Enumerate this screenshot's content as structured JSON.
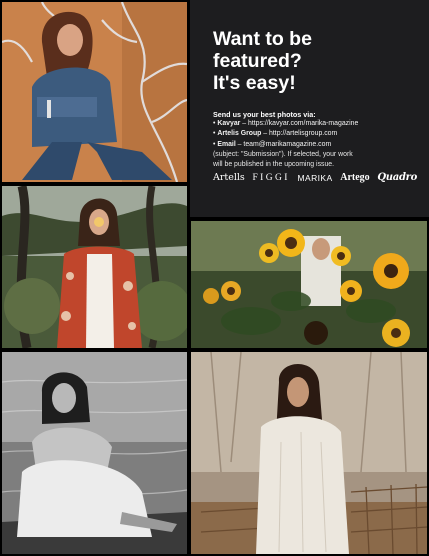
{
  "panel": {
    "headline_lines": [
      "Want to be",
      "featured?",
      "It's easy!"
    ],
    "send_heading": "Send us your best photos via:",
    "contacts": [
      {
        "bullet": "•",
        "name": "Kavyar",
        "detail": "– https://kavyar.com/marika-magazine"
      },
      {
        "bullet": "•",
        "name": "Artelis Group",
        "detail": "– http://artelisgroup.com"
      },
      {
        "bullet": "•",
        "name": "Email",
        "detail": "– team@marikamagazine.com"
      }
    ],
    "note_lines": [
      "(subject: \"Submission\"). If selected, your work",
      "will be published in the upcoming issue."
    ],
    "logos": [
      "Artells",
      "FIGGI",
      "MARIKA",
      "Artego",
      "Quadro"
    ]
  },
  "colors": {
    "page_background": "#000000",
    "panel_background": "#1d1d1f",
    "text": "#ffffff"
  },
  "photos": [
    {
      "name": "photo-denim-model",
      "subject": "woman in denim outfit posing against orange wall with white branch pattern"
    },
    {
      "name": "photo-floral-kimono",
      "subject": "woman in floral red kimono holding flower over face among trees"
    },
    {
      "name": "photo-sunflowers",
      "subject": "person in white shirt among sunflowers"
    },
    {
      "name": "photo-bw-seaside",
      "subject": "black and white woman seated by the sea"
    },
    {
      "name": "photo-knit-sweater",
      "subject": "woman in white knit sweater beside wicker basket"
    }
  ]
}
